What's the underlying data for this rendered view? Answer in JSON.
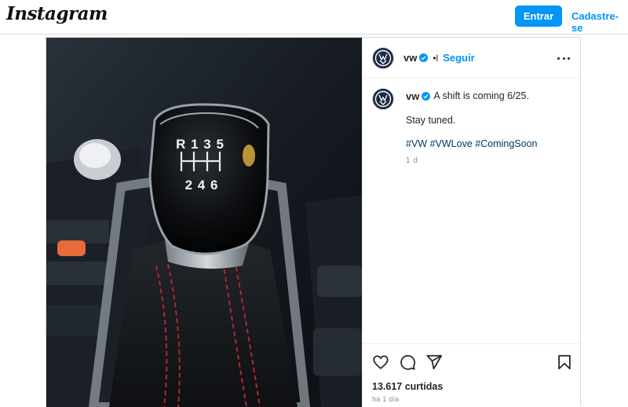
{
  "header": {
    "logo": "Instagram",
    "login_label": "Entrar",
    "signup_label": "Cadastre-se"
  },
  "post": {
    "username": "vw",
    "separator": "•l",
    "follow_label": "Seguir",
    "caption": {
      "username": "vw",
      "text": "A shift is coming 6/25.",
      "line2": "Stay tuned.",
      "hashtags": [
        "#VW",
        "#VWLove",
        "#ComingSoon"
      ],
      "time": "1 d"
    },
    "gear_labels": {
      "row1": "R 1 3 5",
      "row2": "2 4 6"
    },
    "likes": "13.617 curtidas",
    "posted": "há 1 dia"
  },
  "icons": [
    "vw-logo-icon",
    "verified-badge-icon",
    "more-options-icon",
    "heart-icon",
    "comment-icon",
    "share-icon",
    "bookmark-icon"
  ],
  "colors": {
    "accent": "#0095f6",
    "hashtag": "#00376b",
    "muted": "#8e8e8e",
    "avatar_bg": "#1d2a44"
  }
}
